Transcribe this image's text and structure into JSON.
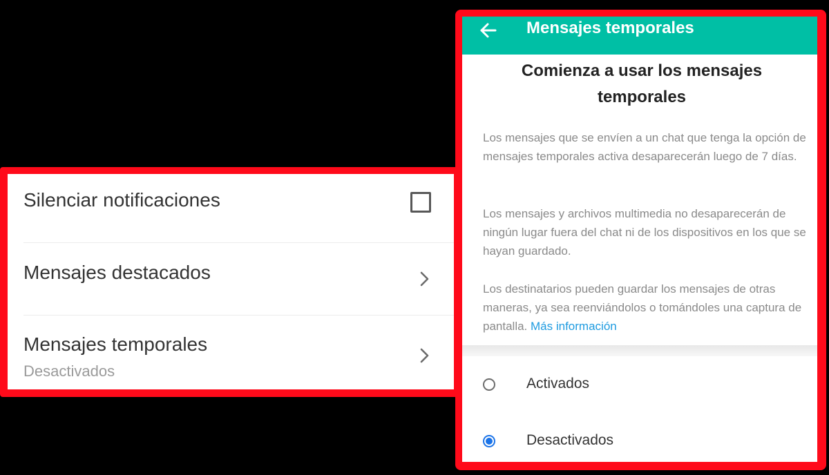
{
  "chat_settings": {
    "mute": {
      "label": "Silenciar notificaciones",
      "checked": false
    },
    "starred": {
      "label": "Mensajes destacados"
    },
    "disappearing": {
      "label": "Mensajes temporales",
      "status": "Desactivados"
    }
  },
  "disappearing_screen": {
    "header_title": "Mensajes temporales",
    "intro_title": "Comienza a usar los mensajes temporales",
    "paragraph_1": "Los mensajes que se envíen a un chat que tenga la opción de mensajes temporales activa desaparecerán luego de 7 días.",
    "paragraph_2": "Los mensajes y archivos multimedia no desaparecerán de ningún lugar fuera del chat ni de los dispositivos en los que se hayan guardado.",
    "paragraph_3": "Los destinatarios pueden guardar los mensajes de otras maneras, ya sea reenviándolos o tomándoles una captura de pantalla.",
    "more_info_link": "Más información",
    "options": [
      {
        "label": "Activados",
        "selected": false
      },
      {
        "label": "Desactivados",
        "selected": true
      }
    ]
  },
  "colors": {
    "highlight_frame": "#ff0a1a",
    "header": "#00bfa5",
    "link": "#1e9be0",
    "radio_selected": "#1a73e8"
  },
  "icons": {
    "back": "arrow-left-icon",
    "row_chevron": "chevron-right-icon",
    "mute_checkbox": "checkbox-icon"
  }
}
